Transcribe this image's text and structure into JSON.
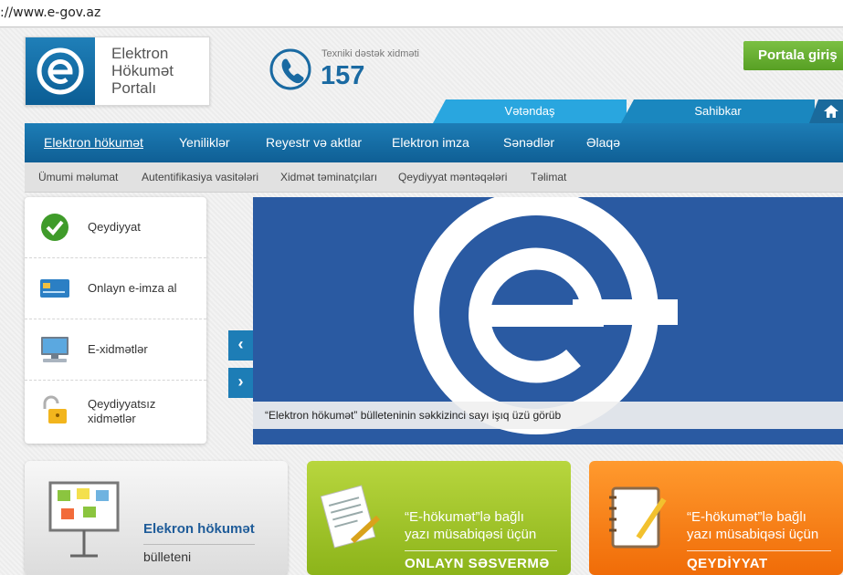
{
  "browser": {
    "url": "://www.e-gov.az"
  },
  "header": {
    "logo_text": "Elektron\nHökumət\nPortalı",
    "support_label": "Texniki dəstək xidməti",
    "support_number": "157",
    "portal_login": "Portala giriş"
  },
  "category_tabs": {
    "citizen": "Vətəndaş",
    "business": "Sahibkar"
  },
  "main_nav": [
    "Elektron hökumət",
    "Yeniliklər",
    "Reyestr və aktlar",
    "Elektron imza",
    "Sənədlər",
    "Əlaqə"
  ],
  "sub_nav": [
    "Ümumi məlumat",
    "Autentifikasiya vasitələri",
    "Xidmət təminatçıları",
    "Qeydiyyat məntəqələri",
    "Təlimat"
  ],
  "side_menu": [
    {
      "label": "Qeydiyyat",
      "icon": "checkmark-icon"
    },
    {
      "label": "Onlayn e-imza al",
      "icon": "id-card-icon"
    },
    {
      "label": "E-xidmətlər",
      "icon": "computer-icon"
    },
    {
      "label": "Qeydiyyatsız\nxidmətlər",
      "icon": "unlocked-padlock-icon"
    }
  ],
  "banner": {
    "caption": "“Elektron hökumət” bülleteninin səkkizinci sayı işıq üzü görüb"
  },
  "tiles": {
    "bulletin": {
      "title": "Elekron hökumət",
      "subtitle": "bülleteni"
    },
    "vote": {
      "text": "“E-hökumət”lə bağlı\nyazı müsabiqəsi üçün",
      "cta": "ONLAYN SƏSVERMƏ"
    },
    "register": {
      "text": "“E-hökumət”lə bağlı\nyazı müsabiqəsi üçün",
      "cta": "QEYDİYYAT"
    }
  },
  "colors": {
    "brand_blue": "#1d7db6",
    "tab_light_blue": "#29a6df",
    "login_green": "#6bb536",
    "tile_green": "#a5c82c",
    "tile_orange": "#f7810f"
  }
}
